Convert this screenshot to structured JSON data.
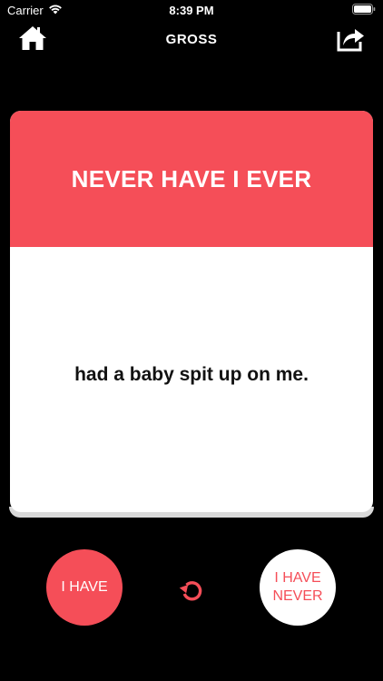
{
  "status_bar": {
    "carrier": "Carrier",
    "time": "8:39 PM",
    "icons": [
      "wifi-icon",
      "battery-icon"
    ]
  },
  "nav": {
    "title": "GROSS",
    "left_icon": "home-icon",
    "right_icon": "share-icon"
  },
  "card": {
    "header": "NEVER HAVE I EVER",
    "statement": "had a baby spit up on me."
  },
  "actions": {
    "i_have_label": "I HAVE",
    "never_line1": "I HAVE",
    "never_line2": "NEVER",
    "reset_icon": "refresh-icon"
  },
  "colors": {
    "accent": "#f54e58",
    "background": "#000000",
    "card": "#ffffff"
  }
}
